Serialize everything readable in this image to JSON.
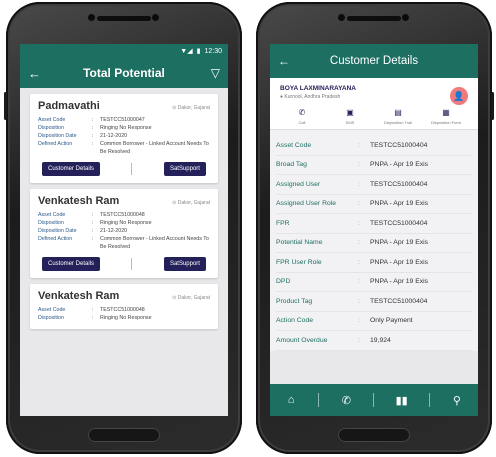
{
  "left": {
    "status_time": "12:30",
    "title": "Total Potential",
    "cards": [
      {
        "name": "Padmavathi",
        "location": "Dakor, Gujarat",
        "rows": [
          {
            "key": "Asset Code",
            "value": "TESTCC51000047"
          },
          {
            "key": "Disposition",
            "value": "Ringing No Response"
          },
          {
            "key": "Disposition Date",
            "value": "21-12-2020"
          },
          {
            "key": "Defined Action",
            "value": "Common Borrower - Linked Account Needs To Be Resolved"
          }
        ],
        "btn1": "Customer Details",
        "btn2": "SatSupport"
      },
      {
        "name": "Venkatesh Ram",
        "location": "Dakor, Gujarat",
        "rows": [
          {
            "key": "Asset Code",
            "value": "TESTCC51000048"
          },
          {
            "key": "Disposition",
            "value": "Ringing No Response"
          },
          {
            "key": "Disposition Date",
            "value": "21-12-2020"
          },
          {
            "key": "Defined Action",
            "value": "Common Borrower - Linked Account Needs To Be Resolved"
          }
        ],
        "btn1": "Customer Details",
        "btn2": "SatSupport"
      },
      {
        "name": "Venkatesh Ram",
        "location": "Dakor, Gujarat",
        "rows": [
          {
            "key": "Asset Code",
            "value": "TESTCC51000048"
          },
          {
            "key": "Disposition",
            "value": "Ringing No Response"
          }
        ]
      }
    ]
  },
  "right": {
    "title": "Customer Details",
    "customer_name": "BOYA LAXMINARAYANA",
    "customer_location": "Kurnool, Andhra Pradesh",
    "actions": [
      "Call",
      "SMS",
      "Disposition Trail",
      "Disposition Form"
    ],
    "details": [
      {
        "key": "Asset Code",
        "value": "TESTCC51000404"
      },
      {
        "key": "Broad Tag",
        "value": "PNPA - Apr 19 Exis"
      },
      {
        "key": "Assigned User",
        "value": "TESTCC51000404"
      },
      {
        "key": "Assigned User Role",
        "value": "PNPA - Apr 19 Exis"
      },
      {
        "key": "FPR",
        "value": "TESTCC51000404"
      },
      {
        "key": "Potential Name",
        "value": "PNPA - Apr 19 Exis"
      },
      {
        "key": "FPR User Role",
        "value": "PNPA - Apr 19 Exis"
      },
      {
        "key": "DPD",
        "value": "PNPA - Apr 19 Exis"
      },
      {
        "key": "Product Tag",
        "value": "TESTCC51000404"
      },
      {
        "key": "Action Code",
        "value": "Only Payment"
      },
      {
        "key": "Amount Overdue",
        "value": "19,924"
      }
    ]
  },
  "icons": {
    "back": "arrow-left-icon",
    "filter": "filter-icon",
    "home": "home-icon",
    "phone": "phone-icon",
    "chart": "chart-icon",
    "profile": "profile-icon"
  },
  "colors": {
    "primary": "#1d6f62",
    "button": "#24215a",
    "avatar": "#ee7b7b"
  }
}
